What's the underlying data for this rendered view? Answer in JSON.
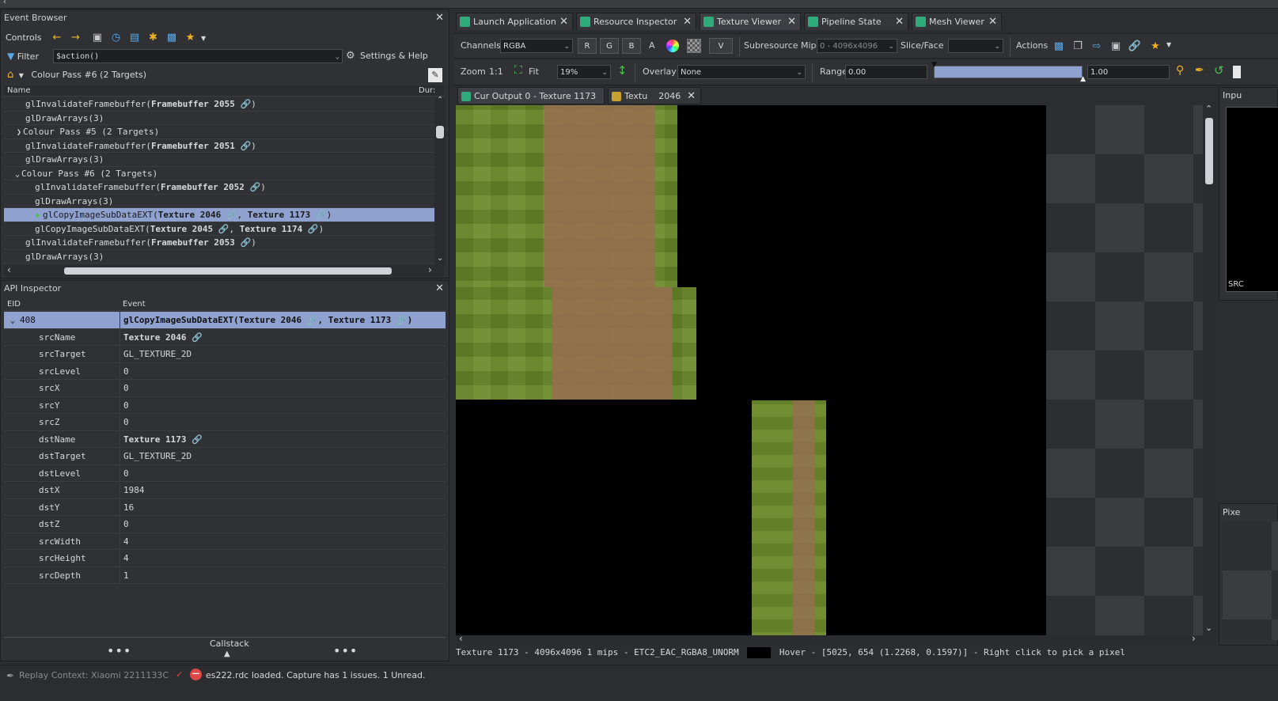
{
  "event_browser": {
    "title": "Event Browser",
    "controls_label": "Controls",
    "filter_label": "Filter",
    "filter_value": "$action()",
    "settings_label": "Settings & Help",
    "breadcrumb": "Colour Pass #6 (2 Targets)",
    "col_name": "Name",
    "col_dur": "Dur:",
    "rows": [
      {
        "pre": "glInvalidateFramebuffer(",
        "bold": "Framebuffer 2055",
        "post": ")",
        "link": true
      },
      {
        "pre": "glDrawArrays(3)",
        "bold": "",
        "post": "",
        "link": false
      },
      {
        "pre": "Colour Pass #5 (2 Targets)",
        "bold": "",
        "post": "",
        "link": false
      },
      {
        "pre": "glInvalidateFramebuffer(",
        "bold": "Framebuffer 2051",
        "post": ")",
        "link": true
      },
      {
        "pre": "glDrawArrays(3)",
        "bold": "",
        "post": "",
        "link": false
      },
      {
        "pre": "Colour Pass #6 (2 Targets)",
        "bold": "",
        "post": "",
        "link": false
      },
      {
        "pre": "glInvalidateFramebuffer(",
        "bold": "Framebuffer 2052",
        "post": ")",
        "link": true
      },
      {
        "pre": "glDrawArrays(3)",
        "bold": "",
        "post": "",
        "link": false
      },
      {
        "pre": "glCopyImageSubDataEXT(",
        "bold": "Texture 2046",
        "mid": ",  ",
        "bold2": "Texture 1173",
        "post": ")",
        "link": true
      },
      {
        "pre": "glCopyImageSubDataEXT(",
        "bold": "Texture 2045",
        "mid": ",  ",
        "bold2": "Texture 1174",
        "post": ")",
        "link": true
      },
      {
        "pre": "glInvalidateFramebuffer(",
        "bold": "Framebuffer 2053",
        "post": ")",
        "link": true
      },
      {
        "pre": "glDrawArrays(3)",
        "bold": "",
        "post": "",
        "link": false
      }
    ]
  },
  "api_inspector": {
    "title": "API Inspector",
    "col_eid": "EID",
    "col_event": "Event",
    "event_eid": "408",
    "event_pre": "glCopyImageSubDataEXT(",
    "event_b1": "Texture 2046",
    "event_mid": ",  ",
    "event_b2": "Texture 1173",
    "event_post": ")",
    "params": [
      {
        "name": "srcName",
        "value": "Texture 2046",
        "bold": true
      },
      {
        "name": "srcTarget",
        "value": "GL_TEXTURE_2D",
        "bold": false
      },
      {
        "name": "srcLevel",
        "value": "0",
        "bold": false
      },
      {
        "name": "srcX",
        "value": "0",
        "bold": false
      },
      {
        "name": "srcY",
        "value": "0",
        "bold": false
      },
      {
        "name": "srcZ",
        "value": "0",
        "bold": false
      },
      {
        "name": "dstName",
        "value": "Texture 1173",
        "bold": true
      },
      {
        "name": "dstTarget",
        "value": "GL_TEXTURE_2D",
        "bold": false
      },
      {
        "name": "dstLevel",
        "value": "0",
        "bold": false
      },
      {
        "name": "dstX",
        "value": "1984",
        "bold": false
      },
      {
        "name": "dstY",
        "value": "16",
        "bold": false
      },
      {
        "name": "dstZ",
        "value": "0",
        "bold": false
      },
      {
        "name": "srcWidth",
        "value": "4",
        "bold": false
      },
      {
        "name": "srcHeight",
        "value": "4",
        "bold": false
      },
      {
        "name": "srcDepth",
        "value": "1",
        "bold": false
      }
    ],
    "callstack_label": "Callstack"
  },
  "tabs": [
    "Launch Application",
    "Resource Inspector",
    "Texture Viewer",
    "Pipeline State",
    "Mesh Viewer"
  ],
  "toolbar": {
    "channels_label": "Channels",
    "channels_value": "RGBA",
    "r": "R",
    "g": "G",
    "b": "B",
    "a": "A",
    "v": "V",
    "subresource_label": "Subresource",
    "mip_label": "Mip",
    "mip_value": "0 - 4096x4096",
    "slice_label": "Slice/Face",
    "actions_label": "Actions",
    "zoom_label": "Zoom",
    "zoom_1to1": "1:1",
    "fit_label": "Fit",
    "zoom_value": "19%",
    "overlay_label": "Overlay",
    "overlay_value": "None",
    "range_label": "Range",
    "range_min": "0.00",
    "range_max": "1.00"
  },
  "subtabs": [
    "Cur Output 0 - Texture 1173",
    "Textu",
    "2046"
  ],
  "side_inputs_label": "Inpu",
  "side_src_label": "SRC",
  "side_pixel_label": "Pixe",
  "status_texture": "Texture 1173 - 4096x4096 1 mips - ETC2_EAC_RGBA8_UNORM",
  "status_hover": "Hover - [5025,  654 (1.2268, 0.1597)] - Right click to pick a pixel",
  "footer": {
    "replay_context": "Replay Context: Xiaomi 2211133C",
    "message": "es222.rdc loaded. Capture has 1 issues. 1 Unread."
  }
}
